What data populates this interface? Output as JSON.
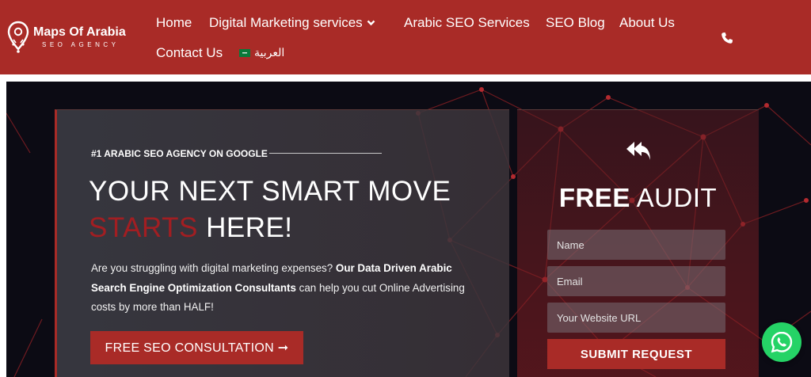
{
  "brand": {
    "name": "Maps Of Arabia",
    "tagline": "SEO AGENCY",
    "icon": "map-pin-logo-icon",
    "color": "#a92b27"
  },
  "nav": {
    "items": [
      {
        "label": "Home"
      },
      {
        "label": "Digital Marketing services",
        "dropdown": true
      },
      {
        "label": "Arabic SEO Services"
      },
      {
        "label": "SEO Blog"
      },
      {
        "label": "About Us"
      },
      {
        "label": "Contact Us"
      },
      {
        "label": "العربية",
        "icon": "flag-icon"
      }
    ],
    "phone_icon": "phone-icon"
  },
  "hero": {
    "eyebrow": "#1 ARABIC SEO AGENCY ON GOOGLE",
    "headline_line1": "YOUR NEXT SMART MOVE",
    "headline_accent": "STARTS",
    "headline_rest": " HERE!",
    "accent_color": "#a21e22",
    "body_intro": "Are you struggling with digital marketing expenses? ",
    "body_bold": "Our Data Driven Arabic Search Engine Optimization Consultants",
    "body_outro": " can help you cut Online Advertising costs by more than HALF!",
    "cta_label": "FREE SEO CONSULTATION ➞"
  },
  "audit": {
    "icon": "reply-all-icon",
    "title_bold": "FREE",
    "title_rest": " AUDIT",
    "fields": {
      "name_placeholder": "Name",
      "email_placeholder": "Email",
      "url_placeholder": "Your Website URL"
    },
    "submit_label": "SUBMIT REQUEST"
  },
  "whatsapp": {
    "icon": "whatsapp-icon",
    "color": "#25d366"
  }
}
